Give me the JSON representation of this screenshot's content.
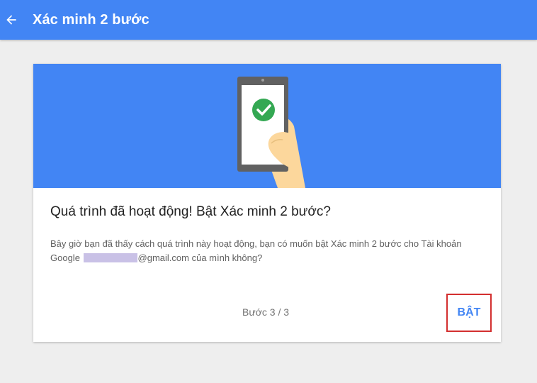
{
  "appbar": {
    "title": "Xác minh 2 bước",
    "back_icon": "arrow-back-icon"
  },
  "card": {
    "illustration": {
      "icon": "phone-check-icon",
      "colors": {
        "background": "#4285f4",
        "phone": "#616161",
        "check": "#34a853",
        "hand": "#fcd79c"
      }
    },
    "heading": "Quá trình đã hoạt động! Bật Xác minh 2 bước?",
    "body_before": "Bây giờ bạn đã thấy cách quá trình này hoạt động, bạn có muốn bật Xác minh 2 bước cho Tài khoản Google ",
    "body_email_suffix": "@gmail.com",
    "body_after": " của mình không?",
    "step_label": "Bước 3 / 3",
    "turn_on_label": "BẬT"
  },
  "colors": {
    "accent": "#4285f4",
    "highlight_border": "#d32f2f"
  }
}
